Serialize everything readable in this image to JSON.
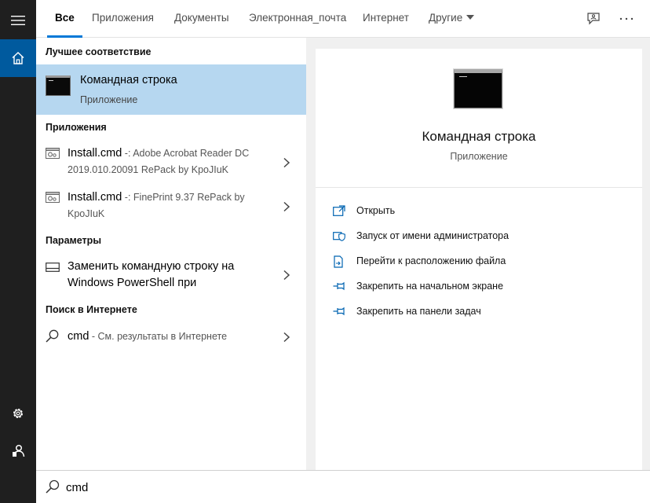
{
  "colors": {
    "accent": "#0078d7",
    "selected_bg": "#b6d7f0",
    "rail_bg": "#1f1f1f",
    "rail_active": "#005a9e"
  },
  "tabs": [
    {
      "label": "Все"
    },
    {
      "label": "Приложения"
    },
    {
      "label": "Документы"
    },
    {
      "label": "Электронная_почта"
    },
    {
      "label": "Интернет"
    },
    {
      "label": "Другие"
    }
  ],
  "rail": {
    "icons": [
      "hamburger-menu-icon",
      "home-icon",
      "settings-gear-icon",
      "account-icon"
    ]
  },
  "top_icons": [
    "feedback-icon",
    "more-options-icon"
  ],
  "results": {
    "best_match_header": "Лучшее соответствие",
    "best_match": {
      "title": "Командная строка",
      "subtitle": "Приложение",
      "icon": "command-prompt-icon"
    },
    "apps_header": "Приложения",
    "apps": [
      {
        "name": "Install.cmd",
        "separator": " -: ",
        "desc": "Adobe Acrobat Reader DC 2019.010.20091 RePack by KpoJIuK",
        "icon": "script-file-icon"
      },
      {
        "name": "Install.cmd",
        "separator": " -: ",
        "desc": "FinePrint 9.37 RePack by KpoJIuK",
        "icon": "script-file-icon"
      }
    ],
    "settings_header": "Параметры",
    "settings": [
      {
        "text": "Заменить командную строку на Windows PowerShell при",
        "icon": "settings-window-icon"
      }
    ],
    "web_header": "Поиск в Интернете",
    "web": [
      {
        "query": "cmd",
        "desc": " - См. результаты в Интернете",
        "icon": "search-icon"
      }
    ]
  },
  "preview": {
    "title": "Командная строка",
    "subtitle": "Приложение",
    "actions": [
      {
        "label": "Открыть",
        "icon": "open-icon"
      },
      {
        "label": "Запуск от имени администратора",
        "icon": "run-as-admin-shield-icon"
      },
      {
        "label": "Перейти к расположению файла",
        "icon": "file-location-icon"
      },
      {
        "label": "Закрепить на начальном экране",
        "icon": "pin-icon"
      },
      {
        "label": "Закрепить на панели задач",
        "icon": "pin-icon"
      }
    ]
  },
  "search": {
    "value": "cmd"
  }
}
